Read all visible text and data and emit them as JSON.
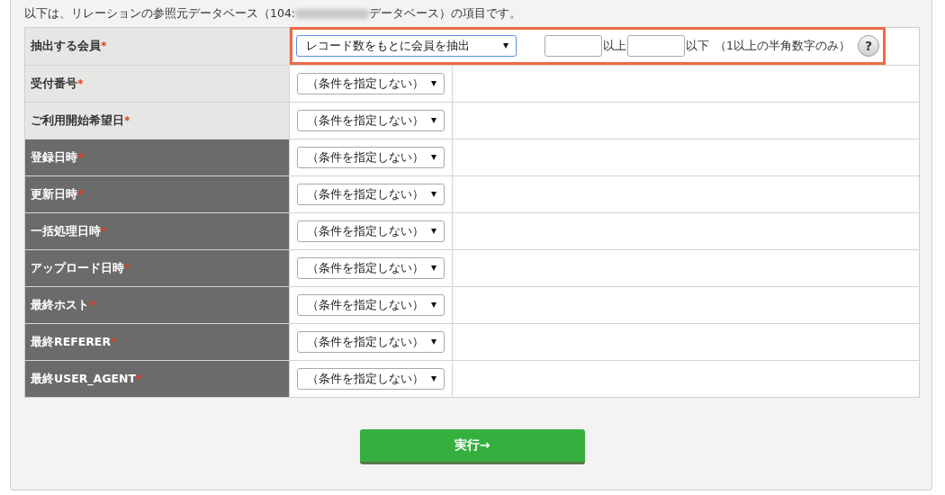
{
  "intro": {
    "before": "以下は、リレーションの参照元データベース（104: ",
    "after": "データベース）の項目です。",
    "redacted": true
  },
  "extract_row": {
    "label": "抽出する会員",
    "required_mark": "*",
    "highlighted": true,
    "select_value": "レコード数をもとに会員を抽出",
    "select_focused": true,
    "min_suffix": "以上",
    "max_suffix": "以下",
    "note": "（1以上の半角数字のみ）",
    "help": "?"
  },
  "rows": [
    {
      "label": "受付番号",
      "required_mark": "*",
      "kind": "custom",
      "value": "（条件を指定しない）"
    },
    {
      "label": "ご利用開始希望日",
      "required_mark": "*",
      "kind": "custom",
      "value": "（条件を指定しない）"
    },
    {
      "label": "登録日時",
      "required_mark": "*",
      "kind": "system",
      "value": "（条件を指定しない）"
    },
    {
      "label": "更新日時",
      "required_mark": "*",
      "kind": "system",
      "value": "（条件を指定しない）"
    },
    {
      "label": "一括処理日時",
      "required_mark": "*",
      "kind": "system",
      "value": "（条件を指定しない）"
    },
    {
      "label": "アップロード日時",
      "required_mark": "*",
      "kind": "system",
      "value": "（条件を指定しない）"
    },
    {
      "label": "最終ホスト",
      "required_mark": "*",
      "kind": "system",
      "value": "（条件を指定しない）"
    },
    {
      "label": "最終REFERER",
      "required_mark": "*",
      "kind": "system",
      "value": "（条件を指定しない）"
    },
    {
      "label": "最終USER_AGENT",
      "required_mark": "*",
      "kind": "system",
      "value": "（条件を指定しない）"
    }
  ],
  "submit": "実行→"
}
